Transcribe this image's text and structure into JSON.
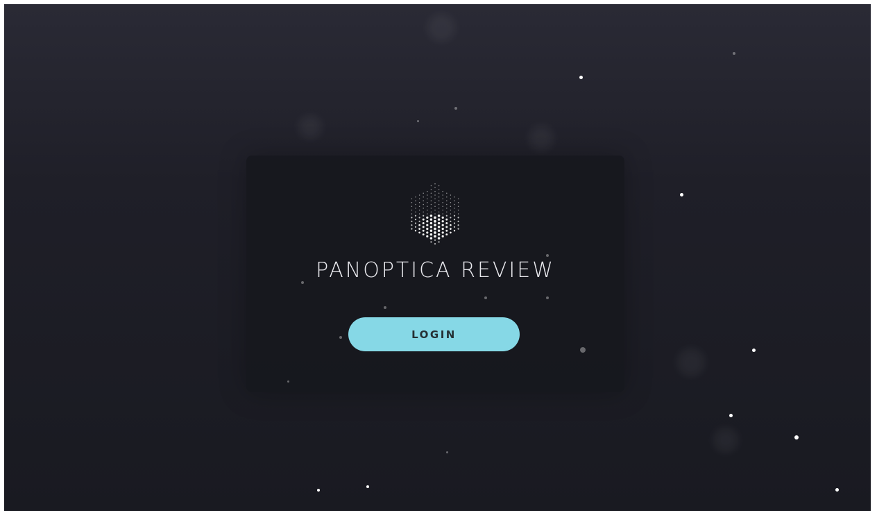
{
  "app": {
    "title": "PANOPTICA REVIEW",
    "logo_icon": "hex-cube-dots-icon"
  },
  "actions": {
    "login_label": "LOGIN"
  },
  "colors": {
    "background": "#1f1f28",
    "card": "#16171d",
    "accent": "#86d8e6",
    "title_text": "#e9e9ee",
    "button_text": "#253034"
  }
}
